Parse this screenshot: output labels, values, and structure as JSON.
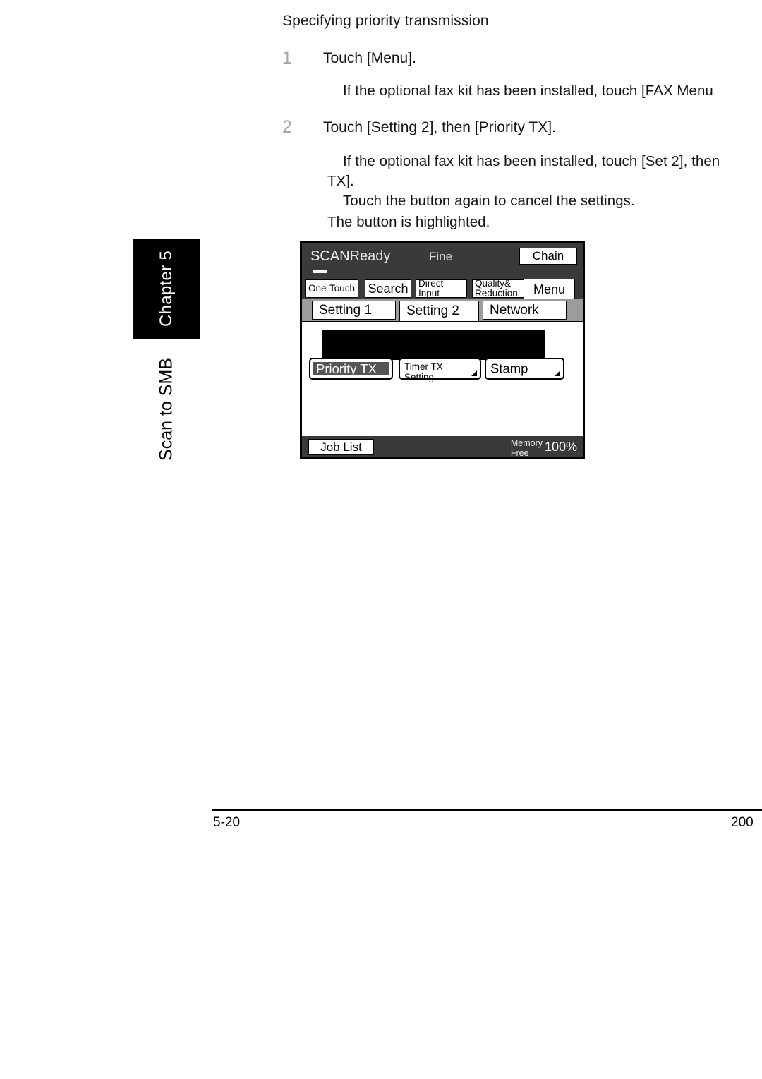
{
  "page": {
    "heading": "Specifying priority transmission",
    "steps": [
      {
        "number": "1",
        "text": "Touch [Menu].",
        "notes": [
          "If the optional fax kit has been installed, touch [FAX Menu"
        ]
      },
      {
        "number": "2",
        "text": "Touch [Setting 2], then [Priority TX].",
        "notes": [
          "If the optional fax kit has been installed, touch [Set 2], then",
          "TX].",
          "Touch the button again to cancel the settings."
        ],
        "outdent_note": "The button is highlighted."
      }
    ]
  },
  "side_tab": {
    "chapter": "Chapter 5",
    "section": "Scan to SMB"
  },
  "lcd": {
    "header": {
      "status_prefix": "SCAN",
      "status_suffix": "Ready",
      "quality": "Fine",
      "chain_label": "Chain"
    },
    "function_buttons": [
      {
        "name": "one-touch",
        "line1": "One-Touch",
        "line2": ""
      },
      {
        "name": "search",
        "line1": "Search",
        "line2": ""
      },
      {
        "name": "direct-input",
        "line1": "Direct",
        "line2": "Input"
      },
      {
        "name": "quality-reduction",
        "line1": "Quality&",
        "line2": "Reduction"
      },
      {
        "name": "menu",
        "line1": "Menu",
        "line2": ""
      }
    ],
    "tabs": [
      {
        "label": "Setting 1",
        "active": false
      },
      {
        "label": "Setting 2",
        "active": true
      },
      {
        "label": "Network",
        "active": false
      }
    ],
    "options": [
      {
        "label": "Priority TX",
        "label2": "",
        "highlighted": true,
        "has_corner": false
      },
      {
        "label": "Timer TX",
        "label2": "Setting",
        "highlighted": false,
        "has_corner": true
      },
      {
        "label": "Stamp",
        "label2": "",
        "highlighted": false,
        "has_corner": true
      }
    ],
    "footer": {
      "job_list_label": "Job List",
      "memory_line1": "Memory",
      "memory_line2": "Free",
      "memory_percent": "100%"
    }
  },
  "footer": {
    "page_number": "5-20",
    "right_text": "200"
  },
  "colors": {
    "lcd_dark": "#3a3a3a",
    "tab_band_gray": "#9c9c9c",
    "highlight_fill": "#555555",
    "step_number_gray": "#a6a6a6"
  }
}
